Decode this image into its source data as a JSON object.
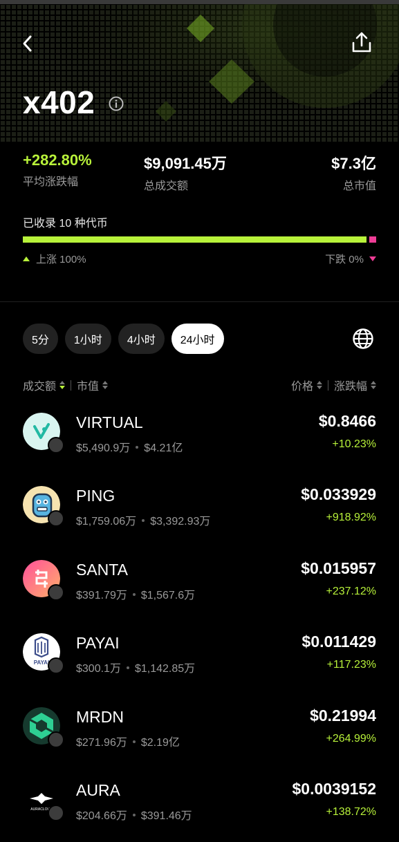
{
  "header": {
    "title": "x402",
    "back_icon": "chevron-left-icon",
    "share_icon": "share-icon",
    "info_icon": "info-icon"
  },
  "stats": {
    "avg_change": {
      "value": "+282.80%",
      "label": "平均涨跌幅"
    },
    "volume": {
      "value": "$9,091.45万",
      "label": "总成交额"
    },
    "market_cap": {
      "value": "$7.3亿",
      "label": "总市值"
    }
  },
  "distribution": {
    "count_text": "已收录 10 种代币",
    "up_text": "上涨 100%",
    "down_text": "下跌 0%",
    "up_fraction": 1.0,
    "down_fraction": 0.0
  },
  "tabs": [
    "5分",
    "1小时",
    "4小时",
    "24小时"
  ],
  "active_tab_index": 3,
  "sort": {
    "volume": "成交额",
    "market_cap": "市值",
    "price": "价格",
    "change": "涨跌幅"
  },
  "tokens": [
    {
      "name": "VIRTUAL",
      "volume": "$5,490.9万",
      "mcap": "$4.21亿",
      "price": "$0.8466",
      "change": "+10.23%",
      "logo": "virtual-logo"
    },
    {
      "name": "PING",
      "volume": "$1,759.06万",
      "mcap": "$3,392.93万",
      "price": "$0.033929",
      "change": "+918.92%",
      "logo": "ping-logo"
    },
    {
      "name": "SANTA",
      "volume": "$391.79万",
      "mcap": "$1,567.6万",
      "price": "$0.015957",
      "change": "+237.12%",
      "logo": "santa-logo"
    },
    {
      "name": "PAYAI",
      "volume": "$300.1万",
      "mcap": "$1,142.85万",
      "price": "$0.011429",
      "change": "+117.23%",
      "logo": "payai-logo",
      "logo_text": "PAYAI"
    },
    {
      "name": "MRDN",
      "volume": "$271.96万",
      "mcap": "$2.19亿",
      "price": "$0.21994",
      "change": "+264.99%",
      "logo": "mrdn-logo"
    },
    {
      "name": "AURA",
      "volume": "$204.66万",
      "mcap": "$391.46万",
      "price": "$0.0039152",
      "change": "+138.72%",
      "logo": "aura-logo",
      "logo_text": "AURACLOUD"
    }
  ],
  "colors": {
    "up": "#b8f23a",
    "down": "#ee3d96",
    "background": "#000000"
  }
}
